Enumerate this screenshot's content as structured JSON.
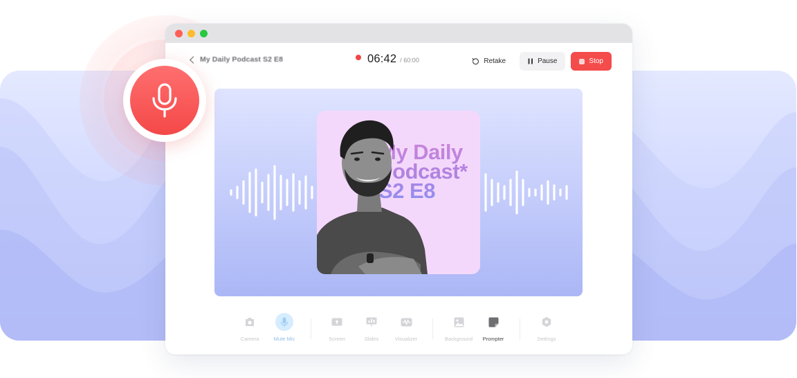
{
  "header": {
    "title": "My Daily Podcast S2 E8",
    "timer": "06:42",
    "time_limit": "/ 60:00",
    "retake_label": "Retake",
    "pause_label": "Pause",
    "stop_label": "Stop"
  },
  "cover": {
    "line1": "My Daily",
    "line2": "Podcast*",
    "line3": "S2 E8"
  },
  "toolbar": {
    "items": [
      {
        "label": "Camera",
        "icon": "camera-icon"
      },
      {
        "label": "Mute Mic",
        "icon": "microphone-icon"
      },
      {
        "label": "Screen",
        "icon": "screen-share-icon"
      },
      {
        "label": "Slides",
        "icon": "slides-icon"
      },
      {
        "label": "Visualizer",
        "icon": "visualizer-icon"
      },
      {
        "label": "Background",
        "icon": "image-icon"
      },
      {
        "label": "Prompter",
        "icon": "prompter-icon"
      },
      {
        "label": "Settings",
        "icon": "gear-icon"
      }
    ]
  },
  "colors": {
    "accent_red": "#f44b4b",
    "stage_top": "#dfe4ff",
    "stage_bottom": "#abb7f6",
    "cover_bg": "#f4d8fb",
    "active_tool": "#d6ecff"
  }
}
